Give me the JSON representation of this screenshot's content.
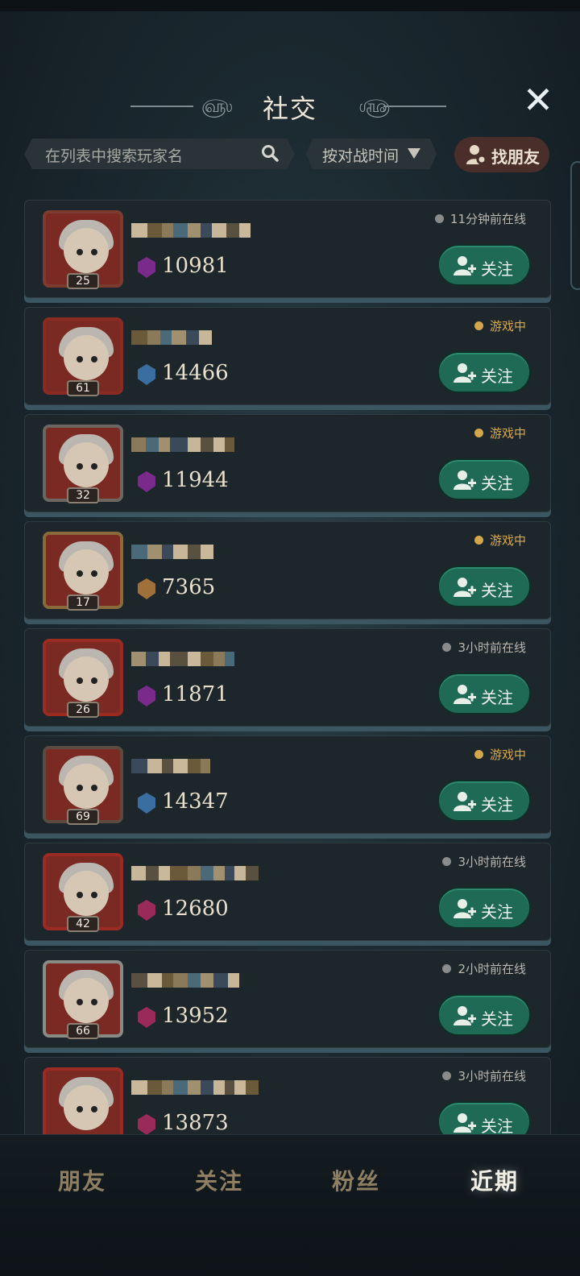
{
  "header": {
    "title": "社交",
    "close_icon": "close-icon"
  },
  "search": {
    "placeholder": "在列表中搜索玩家名",
    "icon": "search-icon"
  },
  "sort": {
    "label": "按对战时间",
    "icon": "triangle-down-icon"
  },
  "find_friend": {
    "label": "找朋友",
    "icon": "person-search-icon"
  },
  "players": [
    {
      "level": "25",
      "score": "10981",
      "status": "11分钟前在线",
      "state": "offline",
      "follow_label": "关注",
      "rank_color": "#7a2a8a",
      "frame_color": "#7b3b2f"
    },
    {
      "level": "61",
      "score": "14466",
      "status": "游戏中",
      "state": "ingame",
      "follow_label": "关注",
      "rank_color": "#3b6ea0",
      "frame_color": "#8a2a22"
    },
    {
      "level": "32",
      "score": "11944",
      "status": "游戏中",
      "state": "ingame",
      "follow_label": "关注",
      "rank_color": "#7a2a8a",
      "frame_color": "#6b6760"
    },
    {
      "level": "17",
      "score": "7365",
      "status": "游戏中",
      "state": "ingame",
      "follow_label": "关注",
      "rank_color": "#a0703a",
      "frame_color": "#8a6a3a"
    },
    {
      "level": "26",
      "score": "11871",
      "status": "3小时前在线",
      "state": "offline",
      "follow_label": "关注",
      "rank_color": "#7a2a8a",
      "frame_color": "#9a2a22"
    },
    {
      "level": "69",
      "score": "14347",
      "status": "游戏中",
      "state": "ingame",
      "follow_label": "关注",
      "rank_color": "#3b6ea0",
      "frame_color": "#5a4a40"
    },
    {
      "level": "42",
      "score": "12680",
      "status": "3小时前在线",
      "state": "offline",
      "follow_label": "关注",
      "rank_color": "#9a2a5a",
      "frame_color": "#9a2a22"
    },
    {
      "level": "66",
      "score": "13952",
      "status": "2小时前在线",
      "state": "offline",
      "follow_label": "关注",
      "rank_color": "#9a2a5a",
      "frame_color": "#8a8a84"
    },
    {
      "level": "",
      "score": "13873",
      "status": "3小时前在线",
      "state": "offline",
      "follow_label": "关注",
      "rank_color": "#9a2a5a",
      "frame_color": "#9a2a22"
    }
  ],
  "tabs": [
    {
      "label": "朋友",
      "active": false
    },
    {
      "label": "关注",
      "active": false
    },
    {
      "label": "粉丝",
      "active": false
    },
    {
      "label": "近期",
      "active": true
    }
  ]
}
